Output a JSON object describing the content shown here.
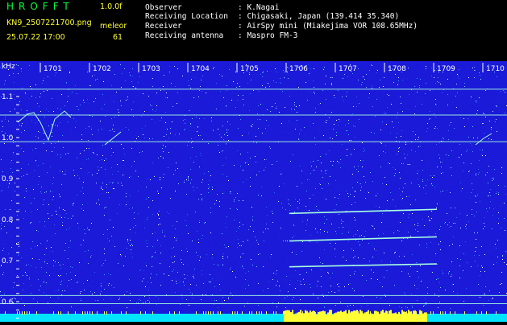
{
  "header": {
    "app_title": "HROFFT",
    "app_version": "1.0.0f",
    "file_name": "KN9_2507221700.png",
    "timestamp": "25.07.22 17:00",
    "mode_label": "meleor",
    "mode_value": "61",
    "info": [
      {
        "label": "Observer",
        "value": ": K.Nagai"
      },
      {
        "label": "Receiving Location",
        "value": ": Chigasaki, Japan (139.414 35.340)"
      },
      {
        "label": "Receiver",
        "value": ": AirSpy mini (Miakejima VOR 108.65MHz)"
      },
      {
        "label": "Receiving antenna",
        "value": ": Maspro FM-3"
      }
    ]
  },
  "colors": {
    "background": "#1a1ad8",
    "text": "#ffffff",
    "accent_green": "#00ff33",
    "accent_yellow": "#ffff33",
    "trace": "#a8ffe0"
  },
  "spectrogram": {
    "unit_label": "kHz",
    "y_axis": {
      "ticks": [
        "1.1",
        "1.0",
        "0.9",
        "0.8",
        "0.7",
        "0.6"
      ]
    },
    "x_axis": {
      "ticks": [
        "1701",
        "1702",
        "1703",
        "1704",
        "1705",
        "1706",
        "1707",
        "1708",
        "1709",
        "1710"
      ]
    },
    "carriers_khz": [
      1.118,
      1.055,
      0.99,
      0.615,
      0.595
    ],
    "streaks": [
      {
        "x0_min": 1705.9,
        "x1_min": 1708.9,
        "f0": 0.815,
        "f1": 0.825
      },
      {
        "x0_min": 1705.9,
        "x1_min": 1708.9,
        "f0": 0.748,
        "f1": 0.758
      },
      {
        "x0_min": 1705.9,
        "x1_min": 1708.9,
        "f0": 0.685,
        "f1": 0.692
      }
    ]
  }
}
